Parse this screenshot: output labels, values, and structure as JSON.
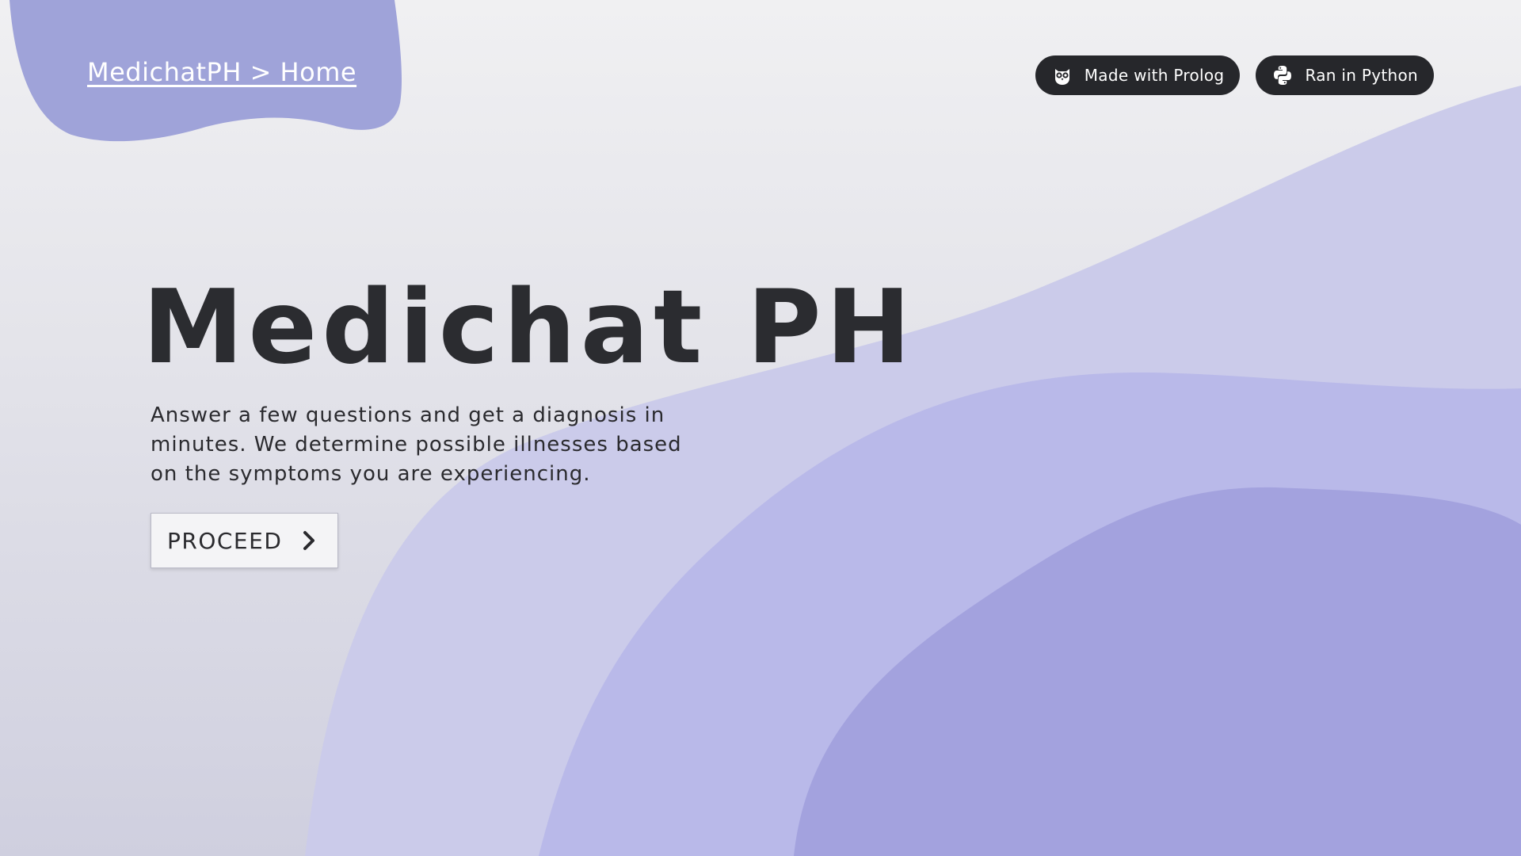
{
  "header": {
    "breadcrumb": "MedichatPH > Home"
  },
  "badges": [
    {
      "label": "Made with Prolog",
      "icon": "owl-icon"
    },
    {
      "label": "Ran in Python",
      "icon": "python-icon"
    }
  ],
  "hero": {
    "title": "Medichat PH",
    "description": "Answer a few questions and get a diagnosis in minutes. We determine possible illnesses based on the symptoms you are experiencing.",
    "button_label": "PROCEED",
    "button_icon": "chevron-right-icon"
  },
  "colors": {
    "blob": "#9fa3d9",
    "wave_light": "#cbcbea",
    "wave_mid": "#b9b9e9",
    "wave_dark": "#a3a2de",
    "badge_bg": "#26272b",
    "text_dark": "#2a2a2e"
  }
}
